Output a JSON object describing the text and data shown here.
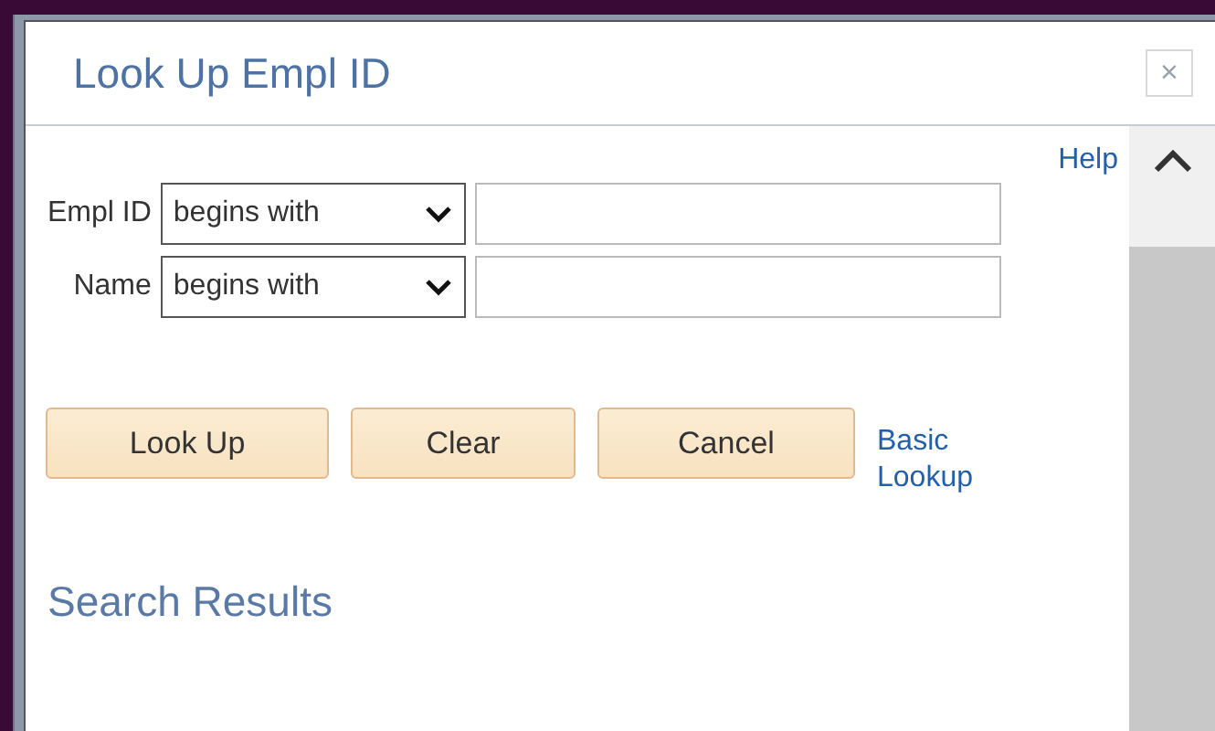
{
  "dialog": {
    "title": "Look Up Empl ID",
    "close": "×"
  },
  "help_link": "Help",
  "criteria": [
    {
      "label": "Empl ID",
      "operator": "begins with"
    },
    {
      "label": "Name",
      "operator": "begins with"
    }
  ],
  "buttons": [
    "Look Up",
    "Clear",
    "Cancel"
  ],
  "basic_lookup_link": "Basic Lookup",
  "results_heading": "Search Results"
}
